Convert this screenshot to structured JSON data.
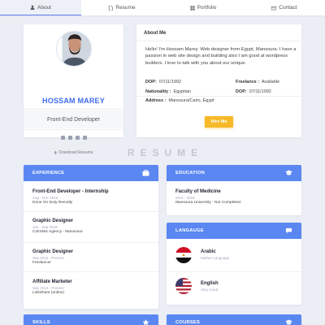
{
  "nav": {
    "tabs": [
      {
        "label": "About",
        "icon": "user-icon",
        "active": true
      },
      {
        "label": "Resume",
        "icon": "file-icon",
        "active": false
      },
      {
        "label": "Portfolio",
        "icon": "grid-icon",
        "active": false
      },
      {
        "label": "Contact",
        "icon": "mail-icon",
        "active": false
      }
    ]
  },
  "profile": {
    "name": "HOSSAM MAREY",
    "role": "Front-End Developer",
    "download_label": "Download Resume",
    "social_icons": [
      "youtube-icon",
      "linkedin-icon",
      "github-icon",
      "behance-icon"
    ]
  },
  "about": {
    "title": "About Me",
    "bio": "Hello! I'm Hossam Marey. Web designer from Egypt, Mansoura. I have a passion in web site design and building also I am good at wordpress builders. I love to talk with you about our unique.",
    "dob_label": "DOP:",
    "dob_value": "07/11/1992",
    "nat_label": "Nationality :",
    "nat_value": "Egyptian",
    "addr_label": "Address :",
    "addr_value": "Mansoura/Cairo, Egypt",
    "free_label": "Freelance :",
    "free_value": "Available",
    "dob2_label": "DOP:",
    "dob2_value": "07/11/1992",
    "hire_label": "Hire Me"
  },
  "resume_title": "RESUME",
  "experience": {
    "title": "EXPERIENCE",
    "items": [
      {
        "title": "Front-End Developer - Internship",
        "date": "Aug - Dec 2019",
        "sub": "Done On Duty Remotly"
      },
      {
        "title": "Graphic Designer",
        "date": "Jan - Sep 2019",
        "sub": "ColorMix Agency - Mansoura"
      },
      {
        "title": "Graphic Designer",
        "date": "Sep 2015 - Present",
        "sub": "Freelancer"
      },
      {
        "title": "Affiliate Marketer",
        "date": "Sep 2015 - Present",
        "sub": "LinkShare (online)"
      }
    ]
  },
  "education": {
    "title": "EDUCATION",
    "items": [
      {
        "title": "Faculty of Medicine",
        "date": "2011 - 2018",
        "sub": "Mansoura University - Not Completed"
      }
    ]
  },
  "language": {
    "title": "LANGAUGE",
    "items": [
      {
        "title": "Arabic",
        "sub": "Mother Language",
        "flag": "egypt-flag"
      },
      {
        "title": "English",
        "sub": "Very Good",
        "flag": "usa-flag"
      }
    ]
  },
  "skills": {
    "title": "SKILLS"
  },
  "courses": {
    "title": "COURSES"
  },
  "colors": {
    "accent": "#5a87f2",
    "name_blue": "#3f6df0",
    "hire": "#f7b928",
    "bg": "#eceef6"
  }
}
